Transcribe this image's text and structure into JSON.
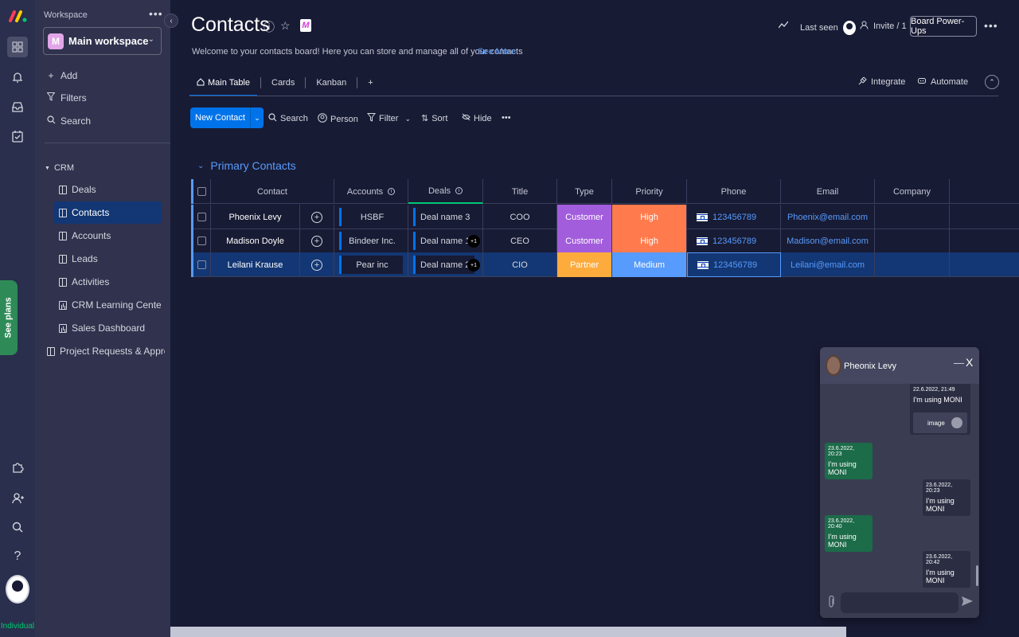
{
  "rail": {
    "see_plans": "See plans",
    "plan": "Individual",
    "icons": [
      "monday-logo",
      "apps-icon",
      "bell-icon",
      "inbox-icon",
      "my-work-icon",
      "puzzle-icon",
      "invite-icon",
      "search-icon",
      "help-icon"
    ]
  },
  "sidebar": {
    "workspace_label": "Workspace",
    "more": "•••",
    "workspace_initial": "M",
    "workspace_name": "Main workspace",
    "add": "Add",
    "filters": "Filters",
    "search": "Search",
    "folder": "CRM",
    "items": [
      {
        "label": "Deals"
      },
      {
        "label": "Contacts"
      },
      {
        "label": "Accounts"
      },
      {
        "label": "Leads"
      },
      {
        "label": "Activities"
      },
      {
        "label": "CRM Learning Center"
      },
      {
        "label": "Sales Dashboard"
      }
    ],
    "project": "Project Requests & Approv..."
  },
  "header": {
    "title": "Contacts",
    "description": "Welcome to your contacts board! Here you can store and manage all of your contacts",
    "see_more": "See More",
    "last_seen": "Last seen",
    "invite": "Invite / 1",
    "power_ups": "Board Power-Ups"
  },
  "tabs": {
    "main": "Main Table",
    "cards": "Cards",
    "kanban": "Kanban",
    "add": "+",
    "integrate": "Integrate",
    "automate": "Automate"
  },
  "toolbar": {
    "new_item": "New Contact",
    "search": "Search",
    "person": "Person",
    "filter": "Filter",
    "sort": "Sort",
    "hide": "Hide",
    "more": "•••"
  },
  "group": {
    "title": "Primary Contacts",
    "columns": [
      "Contact",
      "Accounts",
      "Deals",
      "Title",
      "Type",
      "Priority",
      "Phone",
      "Email",
      "Company"
    ],
    "rows": [
      {
        "contact": "Phoenix Levy",
        "account": "HSBF",
        "deal": "Deal name 3",
        "deal_extra": "",
        "title": "COO",
        "type": "Customer",
        "priority": "High",
        "phone": "123456789",
        "email": "Phoenix@email.com"
      },
      {
        "contact": "Madison Doyle",
        "account": "Bindeer Inc.",
        "deal": "Deal name 1",
        "deal_extra": "+1",
        "title": "CEO",
        "type": "Customer",
        "priority": "High",
        "phone": "123456789",
        "email": "Madison@email.com"
      },
      {
        "contact": "Leilani Krause",
        "account": "Pear inc",
        "deal": "Deal name 2",
        "deal_extra": "+1",
        "title": "CIO",
        "type": "Partner",
        "priority": "Medium",
        "phone": "123456789",
        "email": "Leilani@email.com"
      }
    ]
  },
  "colors": {
    "customer": "#a25ddc",
    "partner": "#fdab3d",
    "high": "#ff7b4d",
    "medium": "#579bfc",
    "accent": "#0073ea"
  },
  "chat": {
    "name": "Pheonix Levy",
    "minimize": "—",
    "close": "X",
    "messages": [
      {
        "dir": "out",
        "time": "22.6.2022, 21:49",
        "text": "I'm using MONI",
        "attachment": "image"
      },
      {
        "dir": "in",
        "time": "23.6.2022, 20:23",
        "text": "I'm using MONI"
      },
      {
        "dir": "out",
        "time": "23.6.2022, 20:23",
        "text": "I'm using MONI"
      },
      {
        "dir": "in",
        "time": "23.6.2022, 20:40",
        "text": "I'm using MONI"
      },
      {
        "dir": "out",
        "time": "23.6.2022, 20:42",
        "text": "I'm using MONI"
      }
    ]
  }
}
